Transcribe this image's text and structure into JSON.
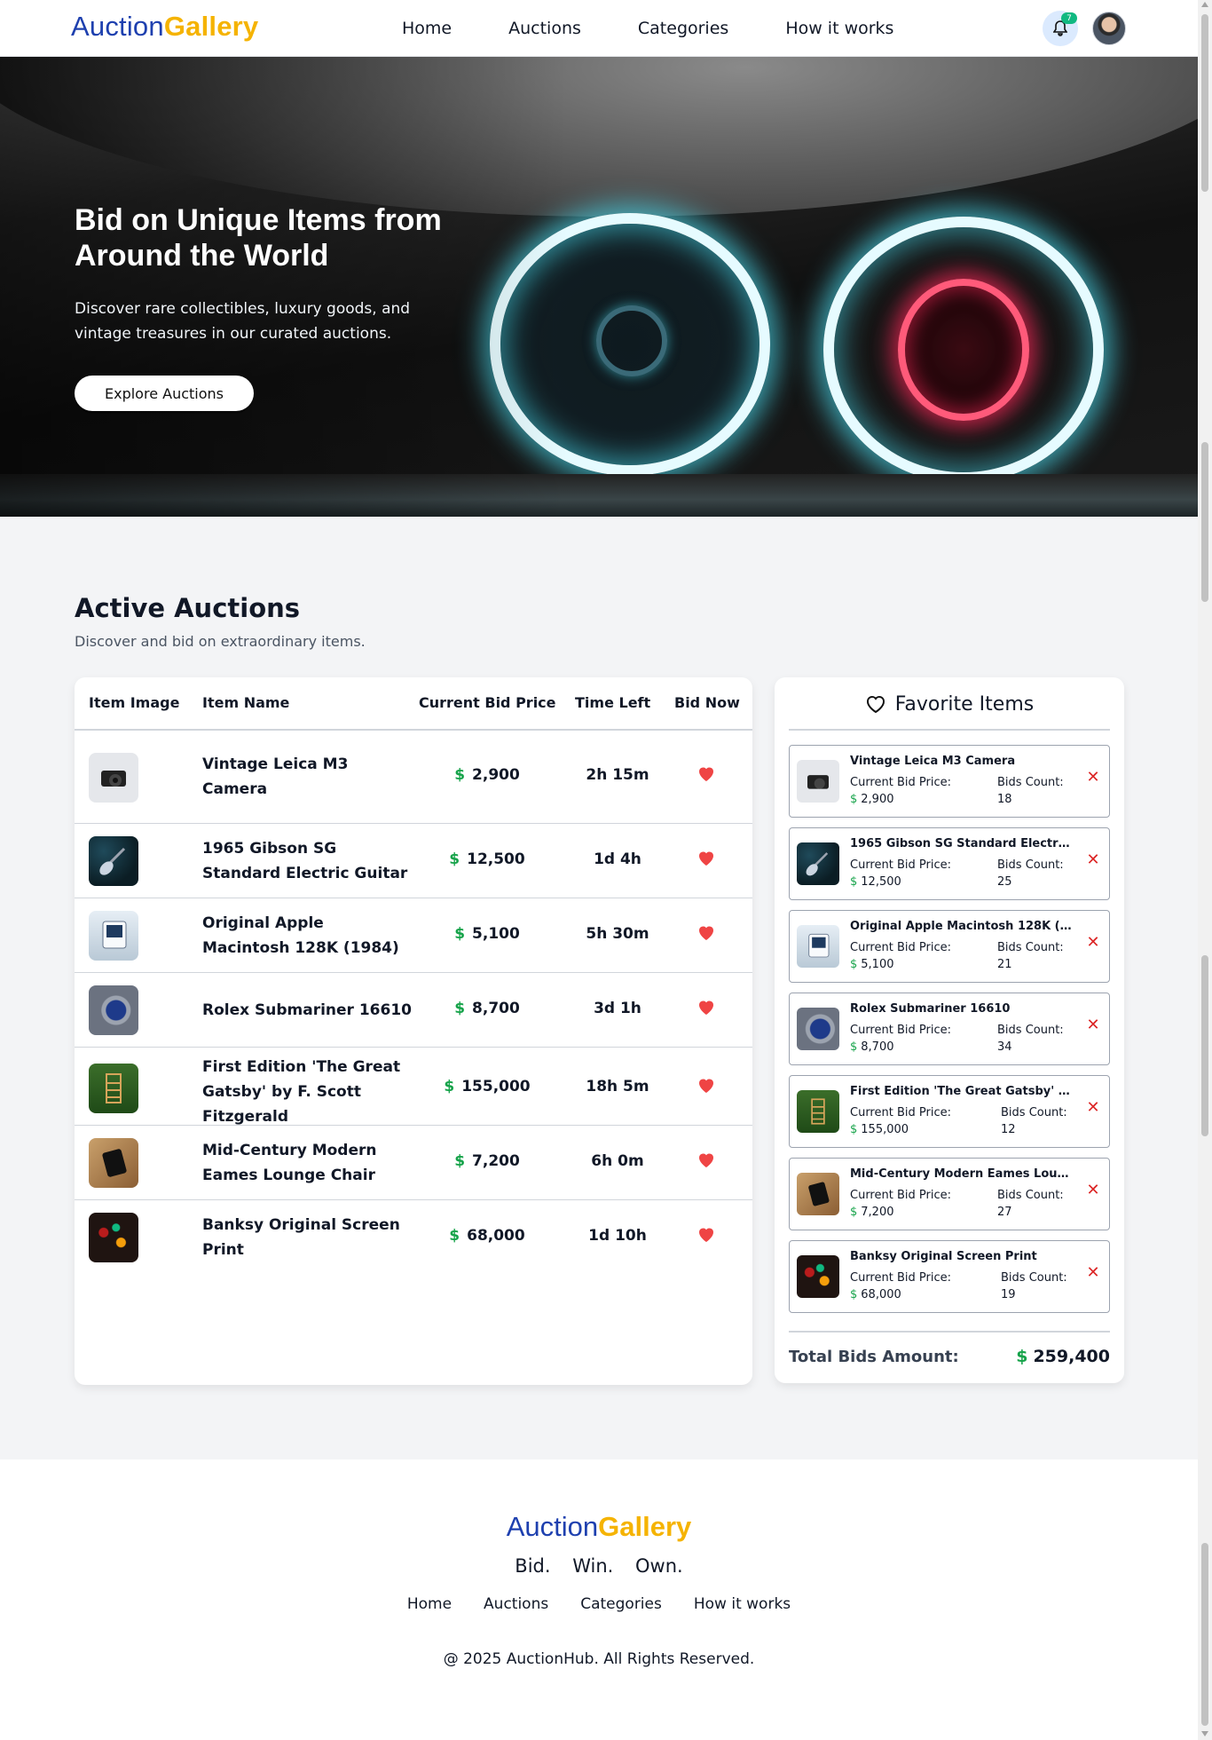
{
  "header": {
    "logo_part1": "Auction",
    "logo_part2": "Gallery",
    "nav": [
      "Home",
      "Auctions",
      "Categories",
      "How it works"
    ],
    "notification_count": "7"
  },
  "hero": {
    "title": "Bid on Unique Items from Around the World",
    "subtitle": "Discover rare collectibles, luxury goods, and vintage treasures in our curated auctions.",
    "cta": "Explore Auctions"
  },
  "section": {
    "title": "Active Auctions",
    "subtitle": "Discover and bid on extraordinary items."
  },
  "table": {
    "headers": [
      "Item Image",
      "Item Name",
      "Current Bid Price",
      "Time Left",
      "Bid Now"
    ],
    "currency": "$",
    "rows": [
      {
        "name": "Vintage Leica M3 Camera",
        "price": "2,900",
        "time": "2h 15m",
        "image": "camera"
      },
      {
        "name": "1965 Gibson SG Standard Electric Guitar",
        "price": "12,500",
        "time": "1d 4h",
        "image": "guitar"
      },
      {
        "name": "Original Apple Macintosh 128K (1984)",
        "price": "5,100",
        "time": "5h 30m",
        "image": "mac"
      },
      {
        "name": "Rolex Submariner 16610",
        "price": "8,700",
        "time": "3d 1h",
        "image": "rolex"
      },
      {
        "name": "First Edition 'The Great Gatsby' by F. Scott Fitzgerald",
        "price": "155,000",
        "time": "18h 5m",
        "image": "gatsby"
      },
      {
        "name": "Mid-Century Modern Eames Lounge Chair",
        "price": "7,200",
        "time": "6h 0m",
        "image": "eames"
      },
      {
        "name": "Banksy Original Screen Print",
        "price": "68,000",
        "time": "1d 10h",
        "image": "banksy"
      }
    ]
  },
  "favorites": {
    "title": "Favorite Items",
    "price_label": "Current Bid Price:",
    "bids_label": "Bids Count:",
    "items": [
      {
        "name": "Vintage Leica M3 Camera",
        "price": "2,900",
        "bids": "18"
      },
      {
        "name": "1965 Gibson SG Standard Electric G...",
        "price": "12,500",
        "bids": "25"
      },
      {
        "name": "Original Apple Macintosh 128K (19...",
        "price": "5,100",
        "bids": "21"
      },
      {
        "name": "Rolex Submariner 16610",
        "price": "8,700",
        "bids": "34"
      },
      {
        "name": "First Edition 'The Great Gatsby' by F...",
        "price": "155,000",
        "bids": "12"
      },
      {
        "name": "Mid-Century Modern Eames Loung...",
        "price": "7,200",
        "bids": "27"
      },
      {
        "name": "Banksy Original Screen Print",
        "price": "68,000",
        "bids": "19"
      }
    ],
    "total_label": "Total Bids Amount:",
    "total_value": "259,400"
  },
  "footer": {
    "logo_part1": "Auction",
    "logo_part2": "Gallery",
    "tagline": "Bid. Win. Own.",
    "nav": [
      "Home",
      "Auctions",
      "Categories",
      "How it works"
    ],
    "copyright": "@ 2025 AuctionHub. All Rights Reserved."
  },
  "colors": {
    "brand_blue": "#1e40af",
    "brand_gold": "#f5b301",
    "price_green": "#16a34a",
    "heart_red": "#ef4444",
    "remove_red": "#dc2626"
  }
}
